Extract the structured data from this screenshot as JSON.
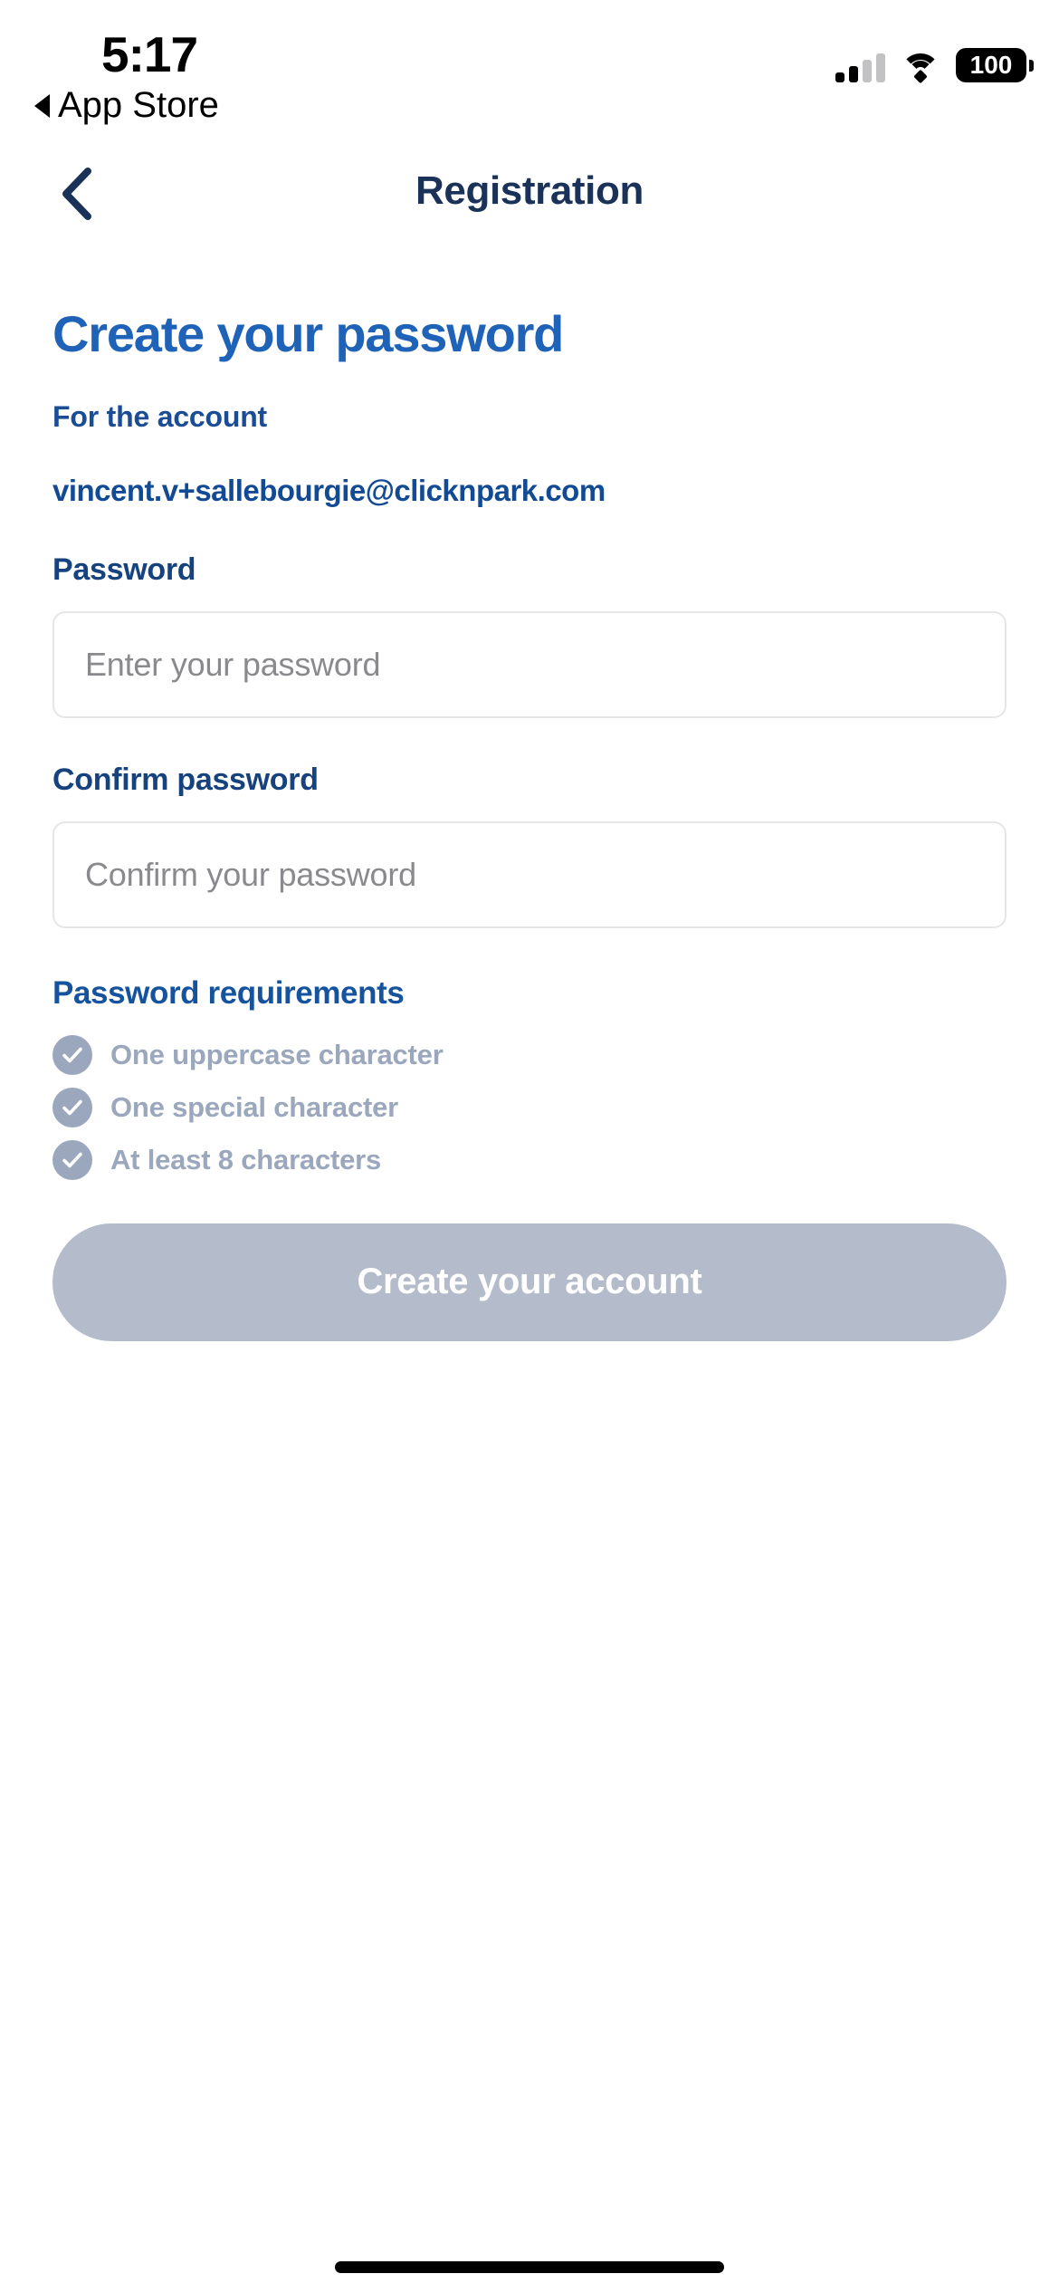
{
  "status_bar": {
    "time": "5:17",
    "back_app_label": "App Store",
    "back_app_icon": "triangle-left-icon",
    "signal_icon": "cellular-signal-icon",
    "signal_bars_filled": 2,
    "signal_bars_total": 4,
    "wifi_icon": "wifi-icon",
    "battery_icon": "battery-icon",
    "battery_level": "100"
  },
  "nav": {
    "back_icon": "chevron-left-icon",
    "title": "Registration"
  },
  "main": {
    "headline": "Create your password",
    "account_label": "For the account",
    "account_email": "vincent.v+sallebourgie@clicknpark.com",
    "password_field": {
      "label": "Password",
      "placeholder": "Enter your password",
      "value": ""
    },
    "confirm_field": {
      "label": "Confirm password",
      "placeholder": "Confirm your password",
      "value": ""
    },
    "requirements": {
      "title": "Password requirements",
      "items": [
        {
          "label": "One uppercase character",
          "icon": "check-circle-icon",
          "met": false
        },
        {
          "label": "One special character",
          "icon": "check-circle-icon",
          "met": false
        },
        {
          "label": "At least 8 characters",
          "icon": "check-circle-icon",
          "met": false
        }
      ]
    },
    "submit_label": "Create your account",
    "submit_enabled": false
  },
  "colors": {
    "headline_blue": "#1f63b8",
    "nav_navy": "#1a3158",
    "label_blue": "#16427e",
    "requirement_gray": "#9aa7bd",
    "button_disabled": "#b4bbca",
    "input_border": "#e6e6e8",
    "placeholder": "#8a8a8e"
  }
}
